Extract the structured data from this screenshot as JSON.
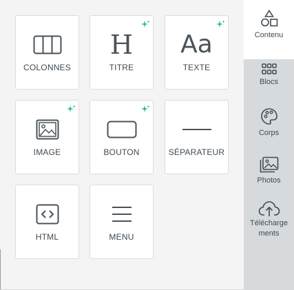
{
  "content_tiles": [
    {
      "label": "COLONNES",
      "icon": "columns-icon",
      "new": false
    },
    {
      "label": "TITRE",
      "icon": "heading-icon",
      "new": true
    },
    {
      "label": "TEXTE",
      "icon": "text-icon",
      "new": true
    },
    {
      "label": "IMAGE",
      "icon": "image-icon",
      "new": true
    },
    {
      "label": "BOUTON",
      "icon": "button-icon",
      "new": true
    },
    {
      "label": "SÉPARATEUR",
      "icon": "divider-icon",
      "new": false
    },
    {
      "label": "HTML",
      "icon": "html-code-icon",
      "new": false
    },
    {
      "label": "MENU",
      "icon": "menu-icon",
      "new": false
    }
  ],
  "sidebar": {
    "active": "Contenu",
    "items": [
      {
        "label": "Contenu",
        "icon": "shapes-icon"
      },
      {
        "label": "Blocs",
        "icon": "blocks-grid-icon"
      },
      {
        "label": "Corps",
        "icon": "palette-icon"
      },
      {
        "label": "Photos",
        "icon": "photos-icon"
      },
      {
        "label": "Télécharge\nments",
        "icon": "cloud-upload-icon"
      }
    ]
  },
  "colors": {
    "panel_bg": "#f4f4f4",
    "tile_bg": "#ffffff",
    "sidebar_bg": "#d6dadd",
    "sparkle": "#1fb89a",
    "icon_stroke": "#4a5358"
  },
  "tile_text": {
    "heading_glyph": "H",
    "text_glyph": "Aa"
  }
}
